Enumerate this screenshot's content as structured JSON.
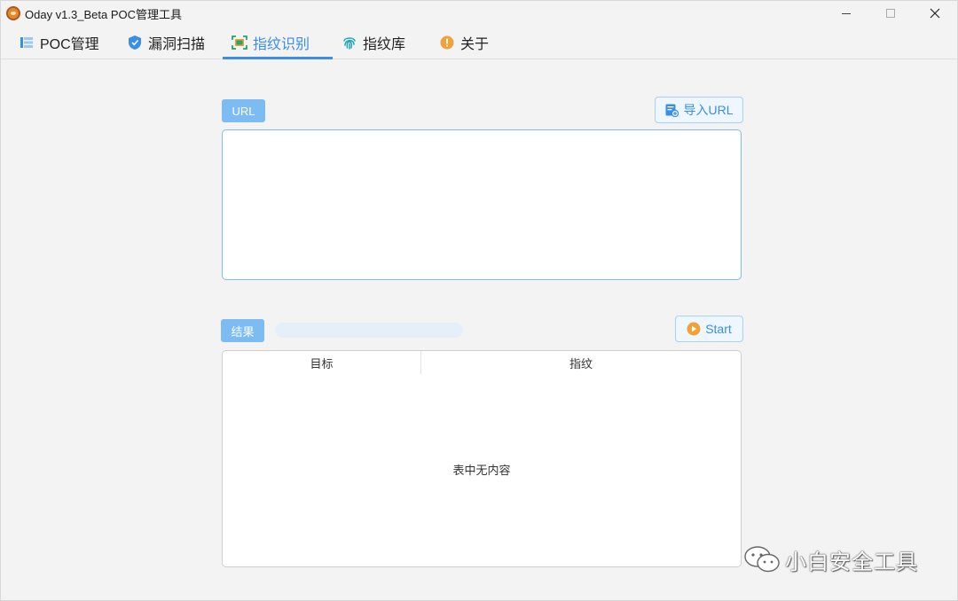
{
  "window": {
    "title": "Oday v1.3_Beta POC管理工具",
    "controls": {
      "minimize": "minimize-icon",
      "maximize": "maximize-icon",
      "close": "close-icon"
    }
  },
  "tabs": [
    {
      "label": "POC管理",
      "icon": "list-icon",
      "active": false
    },
    {
      "label": "漏洞扫描",
      "icon": "shield-icon",
      "active": false
    },
    {
      "label": "指纹识别",
      "icon": "scan-icon",
      "active": true
    },
    {
      "label": "指纹库",
      "icon": "fingerprint-icon",
      "active": false
    },
    {
      "label": "关于",
      "icon": "info-icon",
      "active": false
    }
  ],
  "url_section": {
    "label": "URL",
    "import_button": "导入URL",
    "import_icon": "import-icon",
    "input_value": ""
  },
  "result_section": {
    "label": "结果",
    "progress": 0,
    "start_button": "Start",
    "start_icon": "play-icon",
    "table": {
      "columns": [
        "目标",
        "指纹"
      ],
      "rows": [],
      "empty_message": "表中无内容"
    }
  },
  "watermark": {
    "text": "小白安全工具",
    "icon": "wechat-icon"
  },
  "colors": {
    "accent": "#3a8ee6",
    "pill": "#7cbcf3",
    "background": "#f3f3f3",
    "orange": "#f0a13a"
  }
}
